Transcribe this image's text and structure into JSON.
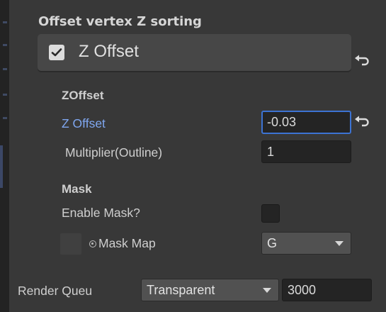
{
  "section_title": "Offset vertex Z sorting",
  "foldout": {
    "label": "Z Offset",
    "checked": true
  },
  "zoffset_group": {
    "header": "ZOffset",
    "z_offset_label": "Z Offset",
    "z_offset_value": "-0.03",
    "multiplier_label": "Multiplier(Outline)",
    "multiplier_value": "1"
  },
  "mask_group": {
    "header": "Mask",
    "enable_mask_label": "Enable Mask?",
    "enable_mask_checked": false,
    "mask_map_label": "Mask Map",
    "mask_map_channel": "G"
  },
  "render_queue": {
    "label": "Render Queu",
    "mode": "Transparent",
    "value": "3000"
  },
  "colors": {
    "background": "#383838",
    "highlight_label": "#7fa7f0",
    "focus_border": "#3c73d3"
  },
  "icons": [
    "checkmark-icon",
    "revert-icon",
    "object-picker-icon",
    "chevron-down-icon"
  ]
}
